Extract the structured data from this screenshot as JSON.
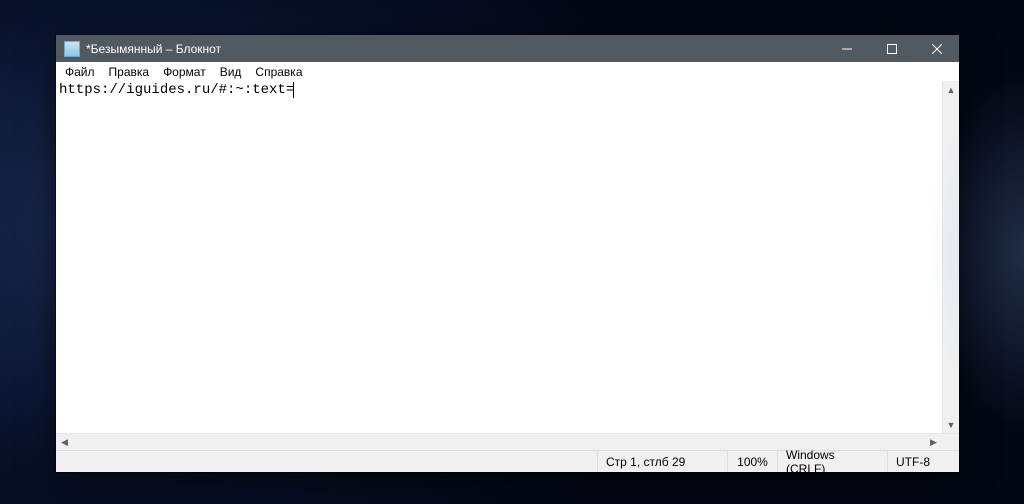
{
  "window": {
    "title": "*Безымянный – Блокнот"
  },
  "menu": {
    "file": "Файл",
    "edit": "Правка",
    "format": "Формат",
    "view": "Вид",
    "help": "Справка"
  },
  "editor": {
    "content": "https://iguides.ru/#:~:text="
  },
  "status": {
    "position": "Стр 1, стлб 29",
    "zoom": "100%",
    "eol": "Windows (CRLF)",
    "encoding": "UTF-8"
  }
}
